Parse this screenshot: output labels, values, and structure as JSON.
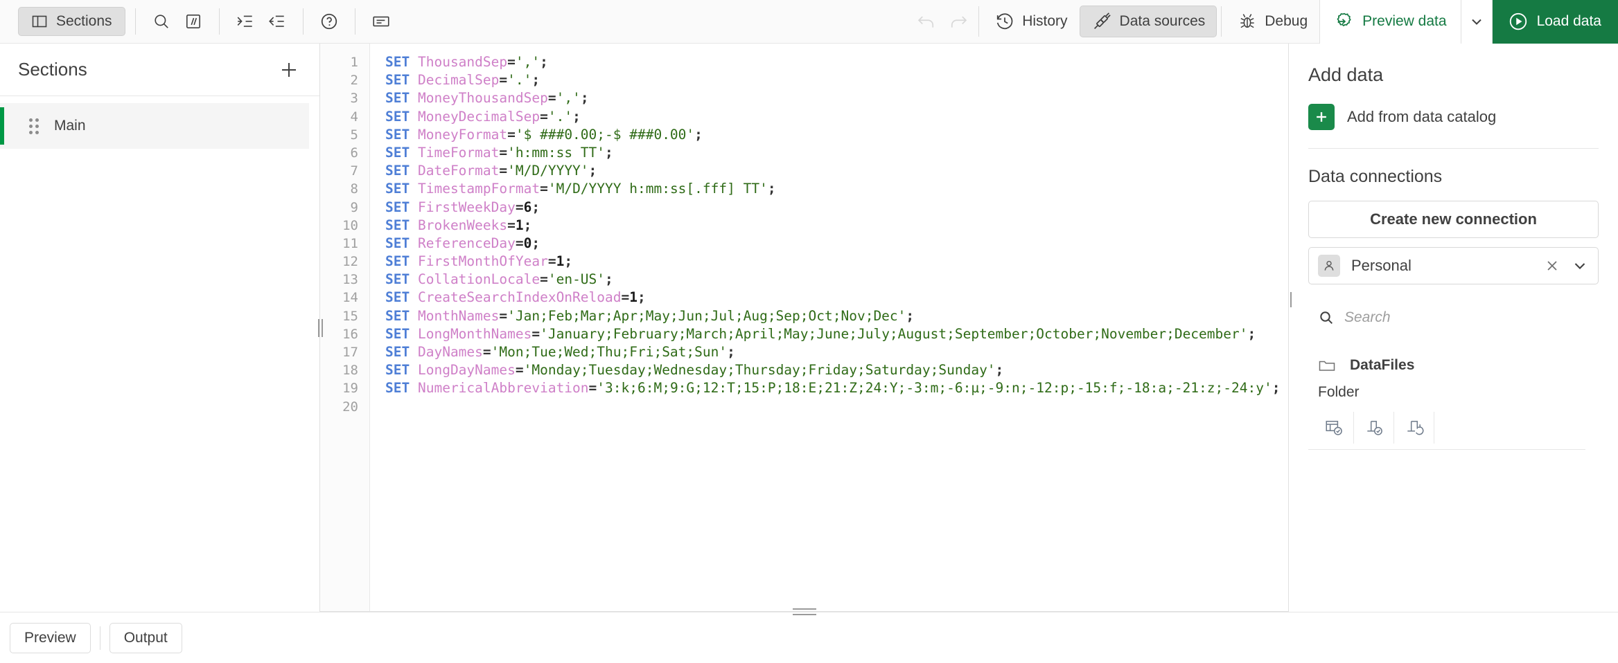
{
  "toolbar": {
    "sections_button": "Sections",
    "icons": [
      {
        "name": "search-icon",
        "tooltip": "Search"
      },
      {
        "name": "comment-icon",
        "tooltip": "Comment"
      },
      {
        "name": "indent-icon",
        "tooltip": "Indent"
      },
      {
        "name": "outdent-icon",
        "tooltip": "Outdent"
      },
      {
        "name": "help-icon",
        "tooltip": "Help"
      },
      {
        "name": "tooltip-icon",
        "tooltip": "Show tooltips"
      }
    ],
    "undo_label": "Undo",
    "redo_label": "Redo",
    "history_label": "History",
    "data_sources_label": "Data sources",
    "debug_label": "Debug",
    "preview_data_label": "Preview data",
    "load_data_label": "Load data",
    "accent_green": "#157a43",
    "active_button": "Data sources"
  },
  "sections": {
    "title": "Sections",
    "add_tooltip": "Add section",
    "items": [
      {
        "label": "Main",
        "selected": true,
        "accent": "#009845"
      }
    ]
  },
  "editor": {
    "line_count": 20,
    "lines": [
      {
        "n": "1",
        "tokens": [
          {
            "t": "kw",
            "v": "SET"
          },
          {
            "t": "sp",
            "v": " "
          },
          {
            "t": "var",
            "v": "ThousandSep"
          },
          {
            "t": "op",
            "v": "="
          },
          {
            "t": "str",
            "v": "','"
          },
          {
            "t": "op",
            "v": ";"
          }
        ]
      },
      {
        "n": "2",
        "tokens": [
          {
            "t": "kw",
            "v": "SET"
          },
          {
            "t": "sp",
            "v": " "
          },
          {
            "t": "var",
            "v": "DecimalSep"
          },
          {
            "t": "op",
            "v": "="
          },
          {
            "t": "str",
            "v": "'.'"
          },
          {
            "t": "op",
            "v": ";"
          }
        ]
      },
      {
        "n": "3",
        "tokens": [
          {
            "t": "kw",
            "v": "SET"
          },
          {
            "t": "sp",
            "v": " "
          },
          {
            "t": "var",
            "v": "MoneyThousandSep"
          },
          {
            "t": "op",
            "v": "="
          },
          {
            "t": "str",
            "v": "','"
          },
          {
            "t": "op",
            "v": ";"
          }
        ]
      },
      {
        "n": "4",
        "tokens": [
          {
            "t": "kw",
            "v": "SET"
          },
          {
            "t": "sp",
            "v": " "
          },
          {
            "t": "var",
            "v": "MoneyDecimalSep"
          },
          {
            "t": "op",
            "v": "="
          },
          {
            "t": "str",
            "v": "'.'"
          },
          {
            "t": "op",
            "v": ";"
          }
        ]
      },
      {
        "n": "5",
        "tokens": [
          {
            "t": "kw",
            "v": "SET"
          },
          {
            "t": "sp",
            "v": " "
          },
          {
            "t": "var",
            "v": "MoneyFormat"
          },
          {
            "t": "op",
            "v": "="
          },
          {
            "t": "str",
            "v": "'$ ###0.00;-$ ###0.00'"
          },
          {
            "t": "op",
            "v": ";"
          }
        ]
      },
      {
        "n": "6",
        "tokens": [
          {
            "t": "kw",
            "v": "SET"
          },
          {
            "t": "sp",
            "v": " "
          },
          {
            "t": "var",
            "v": "TimeFormat"
          },
          {
            "t": "op",
            "v": "="
          },
          {
            "t": "str",
            "v": "'h:mm:ss TT'"
          },
          {
            "t": "op",
            "v": ";"
          }
        ]
      },
      {
        "n": "7",
        "tokens": [
          {
            "t": "kw",
            "v": "SET"
          },
          {
            "t": "sp",
            "v": " "
          },
          {
            "t": "var",
            "v": "DateFormat"
          },
          {
            "t": "op",
            "v": "="
          },
          {
            "t": "str",
            "v": "'M/D/YYYY'"
          },
          {
            "t": "op",
            "v": ";"
          }
        ]
      },
      {
        "n": "8",
        "tokens": [
          {
            "t": "kw",
            "v": "SET"
          },
          {
            "t": "sp",
            "v": " "
          },
          {
            "t": "var",
            "v": "TimestampFormat"
          },
          {
            "t": "op",
            "v": "="
          },
          {
            "t": "str",
            "v": "'M/D/YYYY h:mm:ss[.fff] TT'"
          },
          {
            "t": "op",
            "v": ";"
          }
        ]
      },
      {
        "n": "9",
        "tokens": [
          {
            "t": "kw",
            "v": "SET"
          },
          {
            "t": "sp",
            "v": " "
          },
          {
            "t": "var",
            "v": "FirstWeekDay"
          },
          {
            "t": "op",
            "v": "="
          },
          {
            "t": "num",
            "v": "6"
          },
          {
            "t": "op",
            "v": ";"
          }
        ]
      },
      {
        "n": "10",
        "tokens": [
          {
            "t": "kw",
            "v": "SET"
          },
          {
            "t": "sp",
            "v": " "
          },
          {
            "t": "var",
            "v": "BrokenWeeks"
          },
          {
            "t": "op",
            "v": "="
          },
          {
            "t": "num",
            "v": "1"
          },
          {
            "t": "op",
            "v": ";"
          }
        ]
      },
      {
        "n": "11",
        "tokens": [
          {
            "t": "kw",
            "v": "SET"
          },
          {
            "t": "sp",
            "v": " "
          },
          {
            "t": "var",
            "v": "ReferenceDay"
          },
          {
            "t": "op",
            "v": "="
          },
          {
            "t": "num",
            "v": "0"
          },
          {
            "t": "op",
            "v": ";"
          }
        ]
      },
      {
        "n": "12",
        "tokens": [
          {
            "t": "kw",
            "v": "SET"
          },
          {
            "t": "sp",
            "v": " "
          },
          {
            "t": "var",
            "v": "FirstMonthOfYear"
          },
          {
            "t": "op",
            "v": "="
          },
          {
            "t": "num",
            "v": "1"
          },
          {
            "t": "op",
            "v": ";"
          }
        ]
      },
      {
        "n": "13",
        "tokens": [
          {
            "t": "kw",
            "v": "SET"
          },
          {
            "t": "sp",
            "v": " "
          },
          {
            "t": "var",
            "v": "CollationLocale"
          },
          {
            "t": "op",
            "v": "="
          },
          {
            "t": "str",
            "v": "'en-US'"
          },
          {
            "t": "op",
            "v": ";"
          }
        ]
      },
      {
        "n": "14",
        "tokens": [
          {
            "t": "kw",
            "v": "SET"
          },
          {
            "t": "sp",
            "v": " "
          },
          {
            "t": "var",
            "v": "CreateSearchIndexOnReload"
          },
          {
            "t": "op",
            "v": "="
          },
          {
            "t": "num",
            "v": "1"
          },
          {
            "t": "op",
            "v": ";"
          }
        ]
      },
      {
        "n": "15",
        "tokens": [
          {
            "t": "kw",
            "v": "SET"
          },
          {
            "t": "sp",
            "v": " "
          },
          {
            "t": "var",
            "v": "MonthNames"
          },
          {
            "t": "op",
            "v": "="
          },
          {
            "t": "str",
            "v": "'Jan;Feb;Mar;Apr;May;Jun;Jul;Aug;Sep;Oct;Nov;Dec'"
          },
          {
            "t": "op",
            "v": ";"
          }
        ]
      },
      {
        "n": "16",
        "tokens": [
          {
            "t": "kw",
            "v": "SET"
          },
          {
            "t": "sp",
            "v": " "
          },
          {
            "t": "var",
            "v": "LongMonthNames"
          },
          {
            "t": "op",
            "v": "="
          },
          {
            "t": "str",
            "v": "'January;February;March;April;May;June;July;August;September;October;November;December'"
          },
          {
            "t": "op",
            "v": ";"
          }
        ]
      },
      {
        "n": "17",
        "tokens": [
          {
            "t": "kw",
            "v": "SET"
          },
          {
            "t": "sp",
            "v": " "
          },
          {
            "t": "var",
            "v": "DayNames"
          },
          {
            "t": "op",
            "v": "="
          },
          {
            "t": "str",
            "v": "'Mon;Tue;Wed;Thu;Fri;Sat;Sun'"
          },
          {
            "t": "op",
            "v": ";"
          }
        ]
      },
      {
        "n": "18",
        "tokens": [
          {
            "t": "kw",
            "v": "SET"
          },
          {
            "t": "sp",
            "v": " "
          },
          {
            "t": "var",
            "v": "LongDayNames"
          },
          {
            "t": "op",
            "v": "="
          },
          {
            "t": "str",
            "v": "'Monday;Tuesday;Wednesday;Thursday;Friday;Saturday;Sunday'"
          },
          {
            "t": "op",
            "v": ";"
          }
        ]
      },
      {
        "n": "19",
        "tokens": [
          {
            "t": "kw",
            "v": "SET"
          },
          {
            "t": "sp",
            "v": " "
          },
          {
            "t": "var",
            "v": "NumericalAbbreviation"
          },
          {
            "t": "op",
            "v": "="
          },
          {
            "t": "str",
            "v": "'3:k;6:M;9:G;12:T;15:P;18:E;21:Z;24:Y;-3:m;-6:µ;-9:n;-12:p;-15:f;-18:a;-21:z;-24:y'"
          },
          {
            "t": "op",
            "v": ";"
          }
        ]
      },
      {
        "n": "20",
        "tokens": []
      }
    ],
    "colors": {
      "keyword": "#4f7fd6",
      "variable": "#cf80c8",
      "string": "#2f6b17",
      "number": "#1a1a1a",
      "operator": "#333333",
      "gutter_text": "#a0a0a0"
    }
  },
  "right_panel": {
    "add_data_title": "Add data",
    "add_from_catalog": "Add from data catalog",
    "data_connections_title": "Data connections",
    "create_new_connection": "Create new connection",
    "space": {
      "label": "Personal",
      "avatar_icon": "person-icon",
      "clear_icon": "close-icon",
      "chevron_icon": "chevron-down-icon"
    },
    "search_placeholder": "Search",
    "connections": [
      {
        "name": "DataFiles",
        "type": "Folder",
        "icon": "folder-icon",
        "actions": [
          {
            "name": "select-data-icon",
            "tooltip": "Select data"
          },
          {
            "name": "insert-script-icon",
            "tooltip": "Insert script"
          },
          {
            "name": "replace-script-icon",
            "tooltip": "Replace script"
          }
        ]
      }
    ]
  },
  "bottom_bar": {
    "preview_tab": "Preview",
    "output_tab": "Output"
  }
}
